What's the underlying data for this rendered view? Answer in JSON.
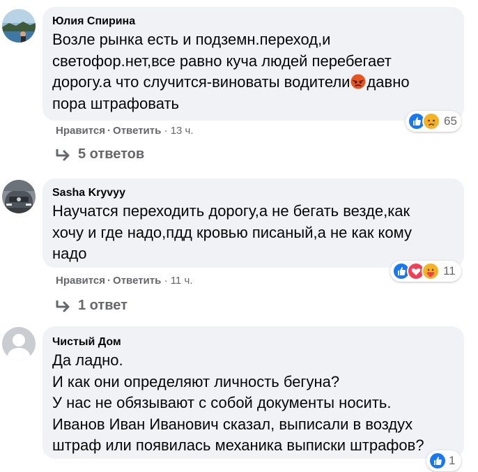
{
  "comments": [
    {
      "author": "Юлия Спирина",
      "text_before_emoji": "Возле рынка есть и подземн.переход,и\nсветофор.нет,все равно куча людей перебегает\nдорогу.а что случится-виноваты водители",
      "inline_emoji": "angry-emoji",
      "text_after_emoji": "давно\nпора штрафовать",
      "like_label": "Нравится",
      "reply_label": "Ответить",
      "time": "13 ч.",
      "reactions": [
        "like",
        "sad"
      ],
      "reaction_count": "65",
      "replies_label": "5 ответов"
    },
    {
      "author": "Sasha Kryvyy",
      "text": "Научатся переходить дорогу,а не бегать везде,как\nхочу и где надо,пдд кровью писаный,а не как кому\nнадо",
      "like_label": "Нравится",
      "reply_label": "Ответить",
      "time": "11 ч.",
      "reactions": [
        "like",
        "love",
        "care"
      ],
      "reaction_count": "11",
      "replies_label": "1 ответ"
    },
    {
      "author": "Чистый Дом",
      "text": "Да ладно.\nИ как они определяют личность бегуна?\nУ нас не обязывают с собой документы носить.\nИванов Иван Иванович сказал, выписали в воздух\nштраф или появилась механика выписки штрафов?",
      "reactions": [
        "like"
      ],
      "reaction_count": "1"
    }
  ],
  "separator": "·",
  "colors": {
    "bubble": "#f0f2f5",
    "meta_text": "#65676b",
    "like_blue": "#1877f2",
    "love_red": "#f33e58",
    "reaction_yellow": "#f7b125"
  }
}
